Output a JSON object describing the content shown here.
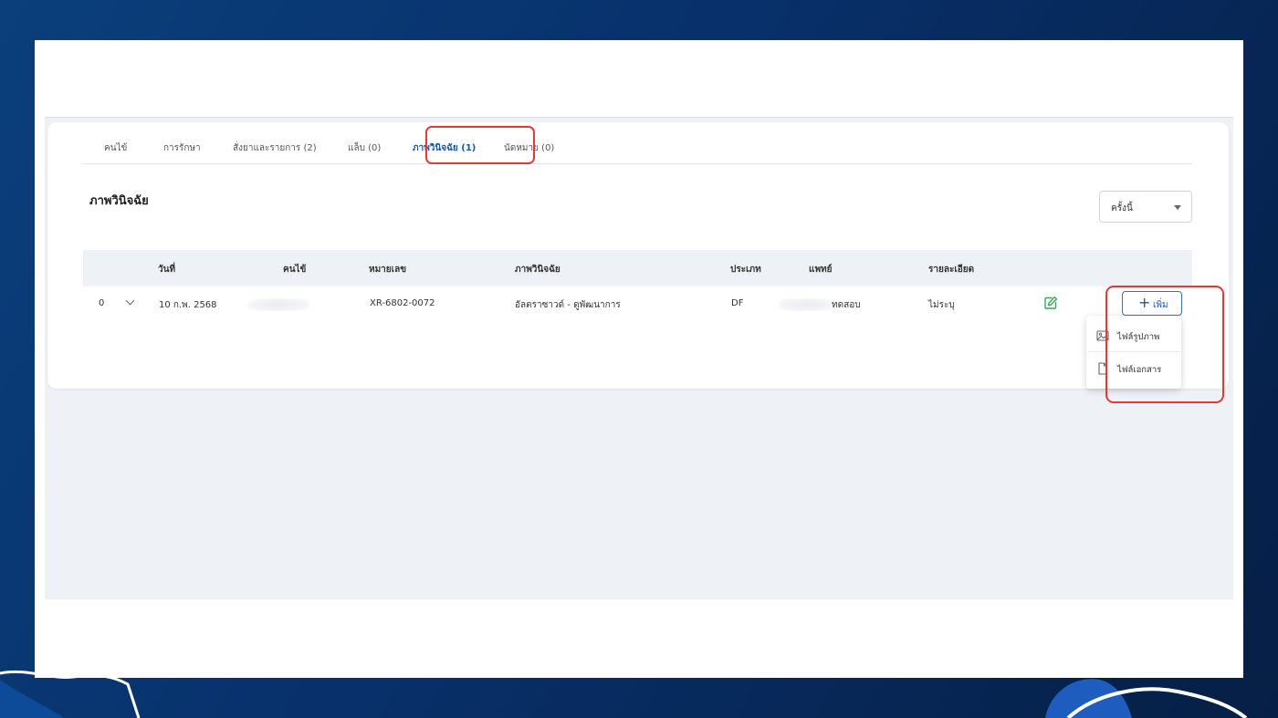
{
  "tabs": [
    {
      "label": "คนไข้"
    },
    {
      "label": "การรักษา"
    },
    {
      "label": "สั่งยาและรายการ (2)"
    },
    {
      "label": "แล็บ (0)"
    },
    {
      "label": "ภาพวินิจฉัย (1)",
      "active": true
    },
    {
      "label": "นัดหมาย (0)"
    }
  ],
  "section": {
    "title": "ภาพวินิจฉัย"
  },
  "filter": {
    "selected": "ครั้งนี้"
  },
  "table": {
    "headers": {
      "date": "วันที่",
      "patient": "คนไข้",
      "number": "หมายเลข",
      "imaging": "ภาพวินิจฉัย",
      "type": "ประเภท",
      "doctor": "แพทย์",
      "detail": "รายละเอียด"
    },
    "rows": [
      {
        "index": "0",
        "date": "10 ก.พ. 2568",
        "number": "XR-6802-0072",
        "imaging": "อัลตราซาวด์ - ดูพัฒนาการ",
        "type": "DF",
        "doctor": "ทดสอบ",
        "detail": "ไม่ระบุ"
      }
    ]
  },
  "add_button": {
    "label": "เพิ่ม"
  },
  "add_menu": {
    "items": [
      {
        "label": "ไฟล์รูปภาพ",
        "icon": "image-icon"
      },
      {
        "label": "ไฟล์เอกสาร",
        "icon": "file-icon"
      }
    ]
  },
  "colors": {
    "accent": "#1a56b0",
    "highlight": "#e53935",
    "edit": "#3aa655",
    "background": "#08306a"
  }
}
